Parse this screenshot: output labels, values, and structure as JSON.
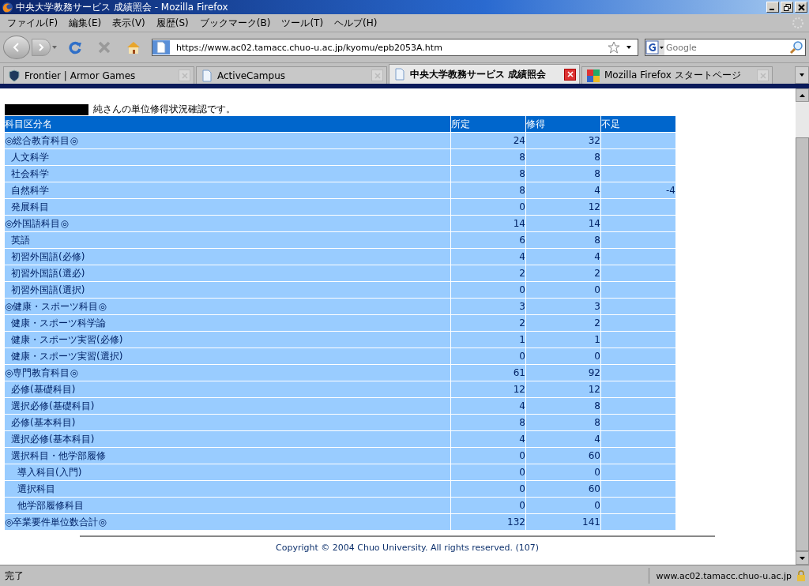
{
  "window": {
    "title": "中央大学教務サービス 成績照会 - Mozilla Firefox"
  },
  "menu": [
    "ファイル(F)",
    "編集(E)",
    "表示(V)",
    "履歴(S)",
    "ブックマーク(B)",
    "ツール(T)",
    "ヘルプ(H)"
  ],
  "address_bar": {
    "value": "https://www.ac02.tamacc.chuo-u.ac.jp/kyomu/epb2053A.htm"
  },
  "search": {
    "placeholder": "Google"
  },
  "tabs": [
    {
      "label": "Frontier | Armor Games",
      "selected": false,
      "kind": "shield"
    },
    {
      "label": "ActiveCampus",
      "selected": false,
      "kind": "page"
    },
    {
      "label": "中央大学教務サービス 成績照会",
      "selected": true,
      "kind": "page"
    },
    {
      "label": "Mozilla Firefox スタートページ",
      "selected": false,
      "kind": "google"
    }
  ],
  "page": {
    "intro": "純さんの単位修得状況確認です。",
    "table": {
      "columns": [
        "科目区分名",
        "所定",
        "修得",
        "不足"
      ],
      "rows": [
        {
          "name": "◎総合教育科目◎",
          "required": "24",
          "earned": "32",
          "children": [
            {
              "name": "人文科学",
              "required": "8",
              "earned": "8"
            },
            {
              "name": "社会科学",
              "required": "8",
              "earned": "8"
            },
            {
              "name": "自然科学",
              "required": "8",
              "earned": "4",
              "shortfall": "-4"
            },
            {
              "name": "発展科目",
              "required": "0",
              "earned": "12"
            }
          ]
        },
        {
          "name": "◎外国語科目◎",
          "required": "14",
          "earned": "14",
          "children": [
            {
              "name": "英語",
              "required": "6",
              "earned": "8"
            },
            {
              "name": "初習外国語(必修)",
              "required": "4",
              "earned": "4"
            },
            {
              "name": "初習外国語(選必)",
              "required": "2",
              "earned": "2"
            },
            {
              "name": "初習外国語(選択)",
              "required": "0",
              "earned": "0"
            }
          ]
        },
        {
          "name": "◎健康・スポーツ科目◎",
          "required": "3",
          "earned": "3",
          "children": [
            {
              "name": "健康・スポーツ科学論",
              "required": "2",
              "earned": "2"
            },
            {
              "name": "健康・スポーツ実習(必修)",
              "required": "1",
              "earned": "1"
            },
            {
              "name": "健康・スポーツ実習(選択)",
              "required": "0",
              "earned": "0"
            }
          ]
        },
        {
          "name": "◎専門教育科目◎",
          "required": "61",
          "earned": "92",
          "children": [
            {
              "name": "必修(基礎科目)",
              "required": "12",
              "earned": "12"
            },
            {
              "name": "選択必修(基礎科目)",
              "required": "4",
              "earned": "8"
            },
            {
              "name": "必修(基本科目)",
              "required": "8",
              "earned": "8"
            },
            {
              "name": "選択必修(基本科目)",
              "required": "4",
              "earned": "4"
            },
            {
              "name": "選択科目・他学部履修",
              "required": "0",
              "earned": "60",
              "children": [
                {
                  "name": "導入科目(入門)",
                  "required": "0",
                  "earned": "0"
                },
                {
                  "name": "選択科目",
                  "required": "0",
                  "earned": "60"
                },
                {
                  "name": "他学部履修科目",
                  "required": "0",
                  "earned": "0"
                }
              ]
            }
          ]
        },
        {
          "name": "◎卒業要件単位数合計◎",
          "required": "132",
          "earned": "141"
        }
      ]
    },
    "footer": "Copyright © 2004 Chuo University. All rights reserved. (107)"
  },
  "status_bar": {
    "text": "完了",
    "host": "www.ac02.tamacc.chuo-u.ac.jp"
  }
}
